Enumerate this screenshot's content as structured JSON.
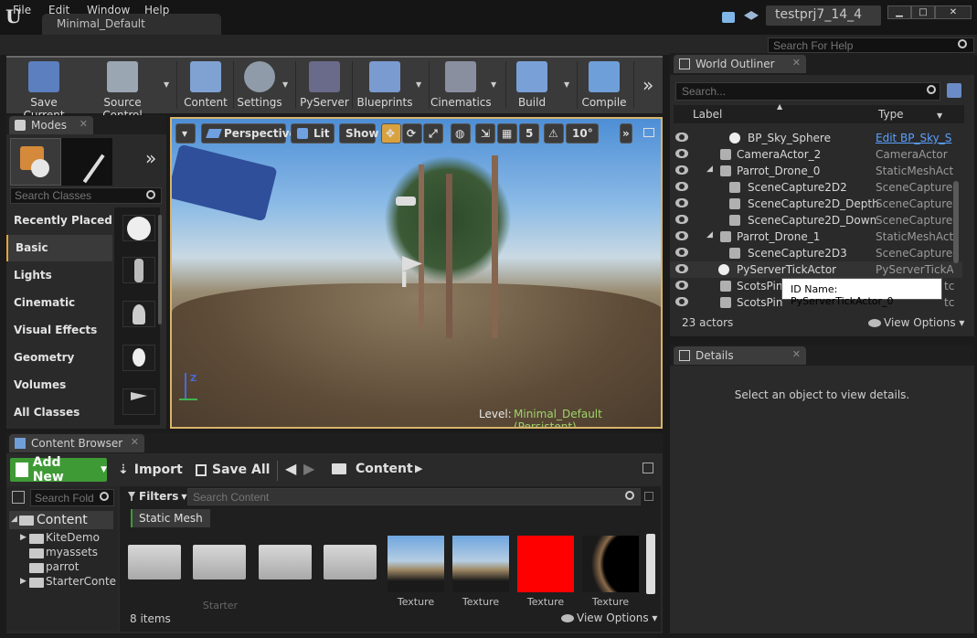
{
  "window": {
    "doc_tab": "Minimal_Default",
    "project": "testprj7_14_4"
  },
  "menu": [
    "File",
    "Edit",
    "Window",
    "Help"
  ],
  "help_search": {
    "placeholder": "Search For Help"
  },
  "toolbar": {
    "save_current": "Save Current",
    "source_control": "Source Control",
    "content": "Content",
    "settings": "Settings",
    "pyserver": "PyServer",
    "blueprints": "Blueprints",
    "cinematics": "Cinematics",
    "build": "Build",
    "compile": "Compile"
  },
  "modes": {
    "tab": "Modes",
    "search_placeholder": "Search Classes",
    "categories": [
      "Recently Placed",
      "Basic",
      "Lights",
      "Cinematic",
      "Visual Effects",
      "Geometry",
      "Volumes",
      "All Classes"
    ],
    "selected": "Basic"
  },
  "viewport": {
    "perspective": "Perspective",
    "lit": "Lit",
    "show": "Show",
    "grid_snap": "5",
    "rot_snap": "10°",
    "level_label": "Level:",
    "level_name": "Minimal_Default (Persistent)"
  },
  "outliner": {
    "tab": "World Outliner",
    "search_placeholder": "Search...",
    "col_label": "Label",
    "col_type": "Type",
    "rows": [
      {
        "label": "BP_Sky_Sphere",
        "type": "Edit BP_Sky_S"
      },
      {
        "label": "CameraActor_2",
        "type": "CameraActor"
      },
      {
        "label": "Parrot_Drone_0",
        "type": "StaticMeshActc"
      },
      {
        "label": "SceneCapture2D2",
        "type": "SceneCapture2"
      },
      {
        "label": "SceneCapture2D_Depth",
        "type": "SceneCapture2"
      },
      {
        "label": "SceneCapture2D_Down",
        "type": "SceneCapture2"
      },
      {
        "label": "Parrot_Drone_1",
        "type": "StaticMeshActc"
      },
      {
        "label": "SceneCapture2D3",
        "type": "SceneCapture2"
      },
      {
        "label": "PyServerTickActor",
        "type": "PyServerTickAc"
      },
      {
        "label": "ScotsPin",
        "type": "tc"
      },
      {
        "label": "ScotsPin",
        "type": "tc"
      }
    ],
    "tooltip": "ID Name: PyServerTickActor_0",
    "count": "23 actors",
    "view_options": "View Options"
  },
  "details": {
    "tab": "Details",
    "empty_msg": "Select an object to view details."
  },
  "content_browser": {
    "tab": "Content Browser",
    "add_new": "Add New",
    "import": "Import",
    "save_all": "Save All",
    "path": "Content",
    "folder_search_placeholder": "Search Fold",
    "filters": "Filters",
    "content_search_placeholder": "Search Content",
    "filter_chip": "Static Mesh",
    "tree": [
      "Content",
      "KiteDemo",
      "myassets",
      "parrot",
      "StarterConte"
    ],
    "tile_labels": [
      "Starter",
      "Texture",
      "Texture",
      "Texture",
      "Texture"
    ],
    "item_count": "8 items",
    "view_options": "View Options"
  },
  "colors": {
    "accent": "#e8a33a",
    "add_new_green": "#3e9a35",
    "highlight_orange": "#d8b36a",
    "red_texture": "#ff0000"
  }
}
